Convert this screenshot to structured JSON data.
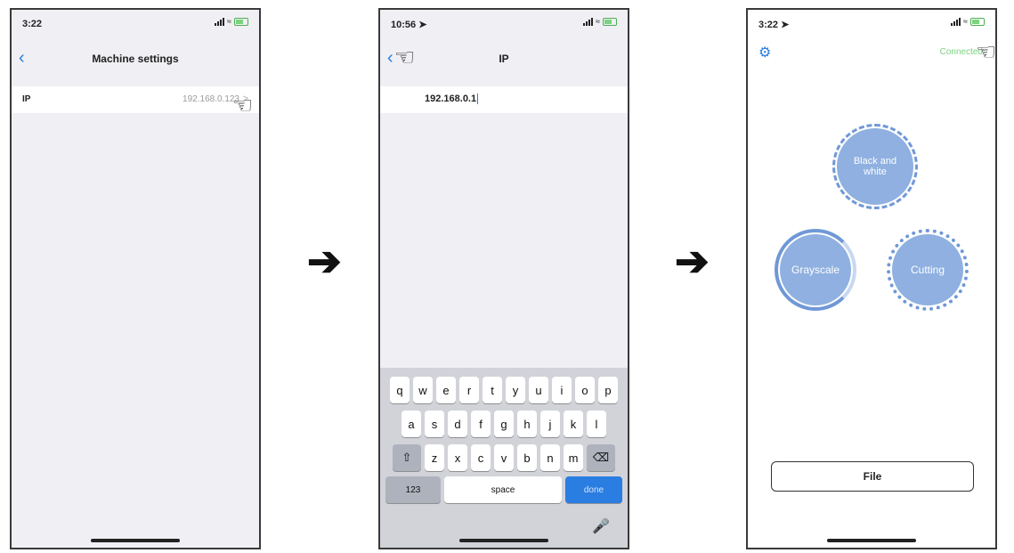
{
  "screen1": {
    "time": "3:22",
    "back_icon": "chevron-left-icon",
    "title": "Machine settings",
    "row_label": "IP",
    "row_value": "192.168.0.123",
    "row_chevron": ">"
  },
  "screen2": {
    "time": "10:56",
    "back_icon": "chevron-left-icon",
    "title": "IP",
    "input_value": "192.168.0.1",
    "keyboard": {
      "row1": [
        "q",
        "w",
        "e",
        "r",
        "t",
        "y",
        "u",
        "i",
        "o",
        "p"
      ],
      "row2": [
        "a",
        "s",
        "d",
        "f",
        "g",
        "h",
        "j",
        "k",
        "l"
      ],
      "row3": [
        "z",
        "x",
        "c",
        "v",
        "b",
        "n",
        "m"
      ],
      "numbers_label": "123",
      "space_label": "space",
      "done_label": "done"
    }
  },
  "screen3": {
    "time": "3:22",
    "status": "Connected",
    "status_color": "#7bd37e",
    "modes": {
      "black_white": "Black and white",
      "grayscale": "Grayscale",
      "cutting": "Cutting"
    },
    "file_button": "File",
    "accent_color": "#2a7de1",
    "mode_color": "#8fb0e0"
  }
}
